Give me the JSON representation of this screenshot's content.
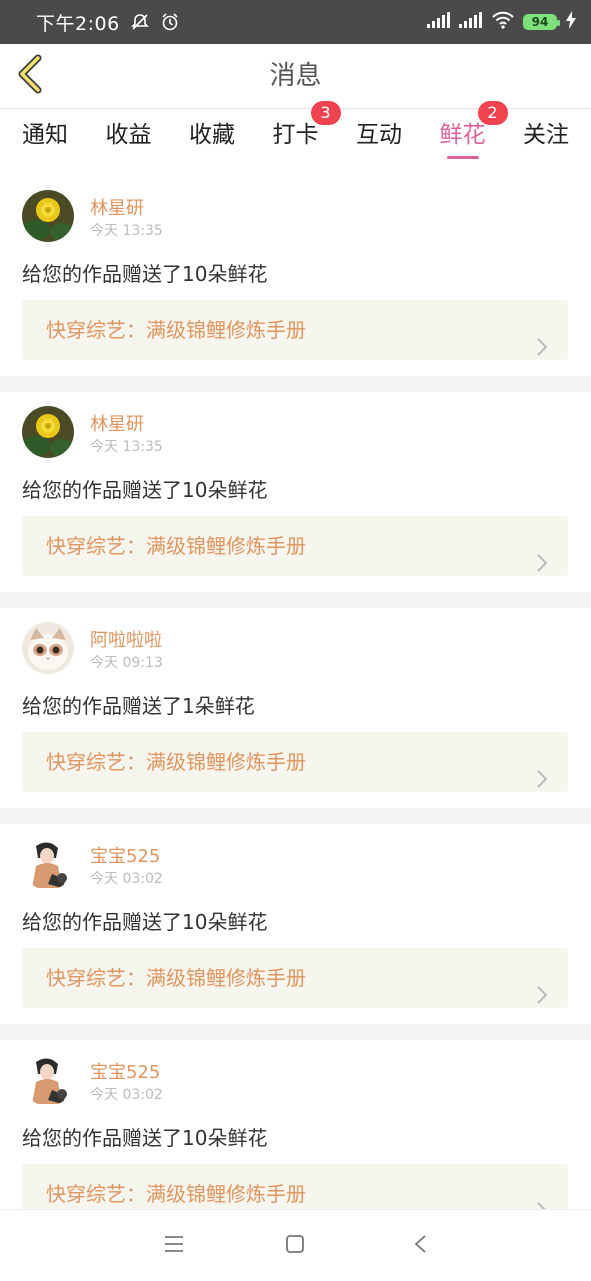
{
  "status_bar": {
    "time": "下午2:06",
    "battery": "94",
    "icons": [
      "mute-icon",
      "alarm-icon",
      "signal-icon",
      "signal-icon",
      "wifi-icon",
      "charging-icon"
    ]
  },
  "header": {
    "title": "消息",
    "back_icon": "chevron-left-icon"
  },
  "tabs": [
    {
      "label": "通知",
      "badge": ""
    },
    {
      "label": "收益",
      "badge": ""
    },
    {
      "label": "收藏",
      "badge": ""
    },
    {
      "label": "打卡",
      "badge": "3"
    },
    {
      "label": "互动",
      "badge": ""
    },
    {
      "label": "鲜花",
      "badge": "2",
      "active": true
    },
    {
      "label": "关注",
      "badge": ""
    }
  ],
  "messages": [
    {
      "user": "林星研",
      "time": "今天 13:35",
      "text": "给您的作品赠送了10朵鲜花",
      "book": "快穿综艺：满级锦鲤修炼手册",
      "avatar": "flower-avatar"
    },
    {
      "user": "林星研",
      "time": "今天 13:35",
      "text": "给您的作品赠送了10朵鲜花",
      "book": "快穿综艺：满级锦鲤修炼手册",
      "avatar": "flower-avatar"
    },
    {
      "user": "阿啦啦啦",
      "time": "今天 09:13",
      "text": "给您的作品赠送了1朵鲜花",
      "book": "快穿综艺：满级锦鲤修炼手册",
      "avatar": "cat-avatar"
    },
    {
      "user": "宝宝525",
      "time": "今天 03:02",
      "text": "给您的作品赠送了10朵鲜花",
      "book": "快穿综艺：满级锦鲤修炼手册",
      "avatar": "illustration-avatar"
    },
    {
      "user": "宝宝525",
      "time": "今天 03:02",
      "text": "给您的作品赠送了10朵鲜花",
      "book": "快穿综艺：满级锦鲤修炼手册",
      "avatar": "illustration-avatar"
    }
  ],
  "colors": {
    "accent": "#e0619a",
    "badge": "#f0434f",
    "name": "#e3955f",
    "book_bg": "#f6f5ee"
  },
  "nav_bar": {
    "icons": [
      "menu-icon",
      "home-square-icon",
      "back-triangle-icon"
    ]
  }
}
